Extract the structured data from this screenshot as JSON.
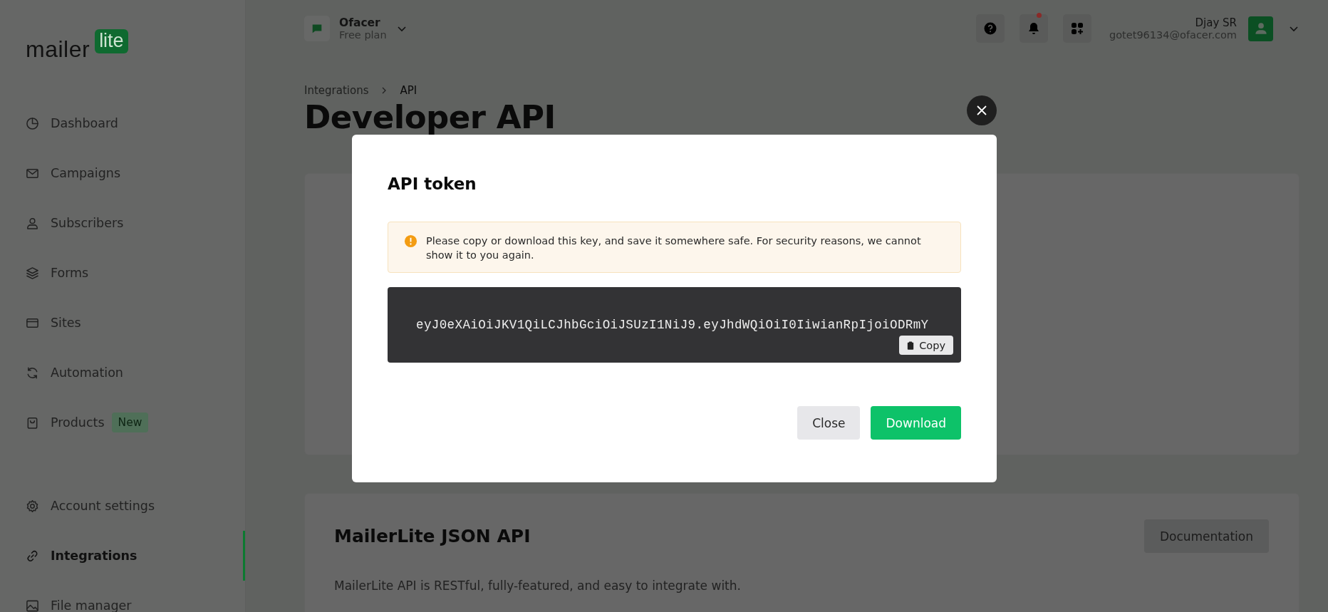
{
  "logo": {
    "word": "mailer",
    "badge": "lite"
  },
  "sidebar": {
    "items": [
      {
        "label": "Dashboard",
        "kind": "pie",
        "selected": false
      },
      {
        "label": "Campaigns",
        "kind": "mail",
        "selected": false
      },
      {
        "label": "Subscribers",
        "kind": "person",
        "selected": false
      },
      {
        "label": "Forms",
        "kind": "layers",
        "selected": false
      },
      {
        "label": "Sites",
        "kind": "browser",
        "selected": false
      },
      {
        "label": "Automation",
        "kind": "refresh",
        "selected": false
      },
      {
        "label": "Products",
        "kind": "bag",
        "selected": false,
        "badge": "New"
      }
    ],
    "bottom_items": [
      {
        "label": "Account settings",
        "kind": "gear",
        "selected": false
      },
      {
        "label": "Integrations",
        "kind": "link",
        "selected": true
      },
      {
        "label": "File manager",
        "kind": "image",
        "selected": false
      }
    ]
  },
  "account": {
    "name": "Ofacer",
    "plan": "Free plan"
  },
  "header": {
    "notifications_unread": true
  },
  "user": {
    "name": "Djay SR",
    "email": "gotet96134@ofacer.com"
  },
  "breadcrumb": [
    "Integrations",
    "API"
  ],
  "page_title": "Developer API",
  "api_card": {
    "title": "MailerLite JSON API",
    "button": "Documentation",
    "description": "MailerLite API is RESTful, fully-featured, and easy to integrate with."
  },
  "modal": {
    "title": "API token",
    "warning": "Please copy or download this key, and save it somewhere safe. For security reasons, we cannot show it to you again.",
    "token": "eyJ0eXAiOiJKV1QiLCJhbGciOiJSUzI1NiJ9.eyJhdWQiOiI0IiwianRpIjoiODRmY",
    "copy_button": "Copy",
    "buttons": [
      {
        "label": "Close",
        "kind": "secondary"
      },
      {
        "label": "Download",
        "kind": "primary"
      }
    ]
  }
}
